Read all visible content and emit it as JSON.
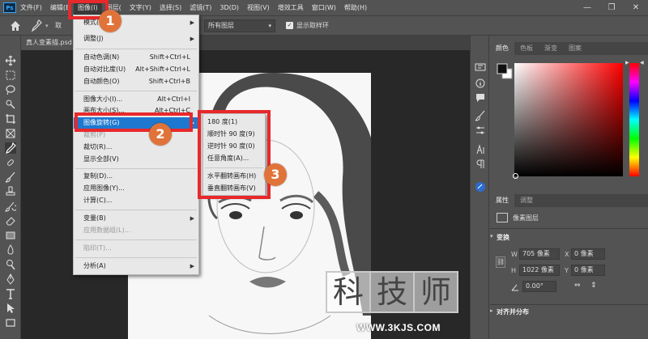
{
  "menubar": {
    "logo": "Ps",
    "items": [
      "文件(F)",
      "编辑(E",
      "图像(I)",
      "图层(",
      "文字(Y)",
      "选择(S)",
      "滤镜(T)",
      "3D(D)",
      "视图(V)",
      "增效工具",
      "窗口(W)",
      "帮助(H)"
    ],
    "active_index": 2,
    "window_controls": [
      "—",
      "❐",
      "✕"
    ]
  },
  "options_bar": {
    "sample_label": "取",
    "sample_select": "所有图层",
    "show_ring_label": "显示取样环"
  },
  "document_tab": "真人变素描.psd",
  "image_menu": {
    "items": [
      {
        "label": "模式(M)",
        "shortcut": "",
        "submenu": true,
        "disabled": false
      },
      {
        "label": "调整(J)",
        "shortcut": "",
        "submenu": true,
        "disabled": false
      },
      {
        "label": "自动色调(N)",
        "shortcut": "Shift+Ctrl+L",
        "submenu": false,
        "disabled": false
      },
      {
        "label": "自动对比度(U)",
        "shortcut": "Alt+Shift+Ctrl+L",
        "submenu": false,
        "disabled": false
      },
      {
        "label": "自动颜色(O)",
        "shortcut": "Shift+Ctrl+B",
        "submenu": false,
        "disabled": false
      },
      {
        "label": "图像大小(I)...",
        "shortcut": "Alt+Ctrl+I",
        "submenu": false,
        "disabled": false
      },
      {
        "label": "画布大小(S)...",
        "shortcut": "Alt+Ctrl+C",
        "submenu": false,
        "disabled": false
      },
      {
        "label": "图像旋转(G)",
        "shortcut": "",
        "submenu": true,
        "disabled": false
      },
      {
        "label": "裁剪(P)",
        "shortcut": "",
        "submenu": false,
        "disabled": true
      },
      {
        "label": "裁切(R)...",
        "shortcut": "",
        "submenu": false,
        "disabled": false
      },
      {
        "label": "显示全部(V)",
        "shortcut": "",
        "submenu": false,
        "disabled": false
      },
      {
        "label": "复制(D)...",
        "shortcut": "",
        "submenu": false,
        "disabled": false
      },
      {
        "label": "应用图像(Y)...",
        "shortcut": "",
        "submenu": false,
        "disabled": false
      },
      {
        "label": "计算(C)...",
        "shortcut": "",
        "submenu": false,
        "disabled": false
      },
      {
        "label": "变量(B)",
        "shortcut": "",
        "submenu": true,
        "disabled": false
      },
      {
        "label": "应用数据组(L)...",
        "shortcut": "",
        "submenu": false,
        "disabled": true
      },
      {
        "label": "陷印(T)...",
        "shortcut": "",
        "submenu": false,
        "disabled": true
      },
      {
        "label": "分析(A)",
        "shortcut": "",
        "submenu": true,
        "disabled": false
      }
    ]
  },
  "rotation_submenu": {
    "items": [
      "180 度(1)",
      "顺时针 90 度(9)",
      "逆时针 90 度(0)",
      "任意角度(A)...",
      "水平翻转画布(H)",
      "垂直翻转画布(V)"
    ]
  },
  "step_markers": [
    "1",
    "2",
    "3"
  ],
  "color_panel": {
    "tabs": [
      "颜色",
      "色板",
      "渐变",
      "图案"
    ],
    "active_tab": 0,
    "foreground": "#111111",
    "background": "#ffffff",
    "hue": "#ff0000"
  },
  "properties_panel": {
    "tabs": [
      "属性",
      "调整"
    ],
    "active_tab": 0,
    "layer_type": "像素图层",
    "transform_heading": "变换",
    "w_label": "W",
    "w_value": "705 像素",
    "h_label": "H",
    "h_value": "1022 像素",
    "x_label": "X",
    "x_value": "0 像素",
    "y_label": "Y",
    "y_value": "0 像素",
    "angle_value": "0.00°",
    "align_heading": "对齐并分布"
  },
  "watermark": {
    "chars": [
      "科",
      "技",
      "师"
    ],
    "url": "WWW.3KJS.COM"
  },
  "colors": {
    "ui_bg": "#535353",
    "menu_highlight": "#1e78d0",
    "annotation_red": "#e8282b",
    "marker_orange": "#e0733a"
  }
}
